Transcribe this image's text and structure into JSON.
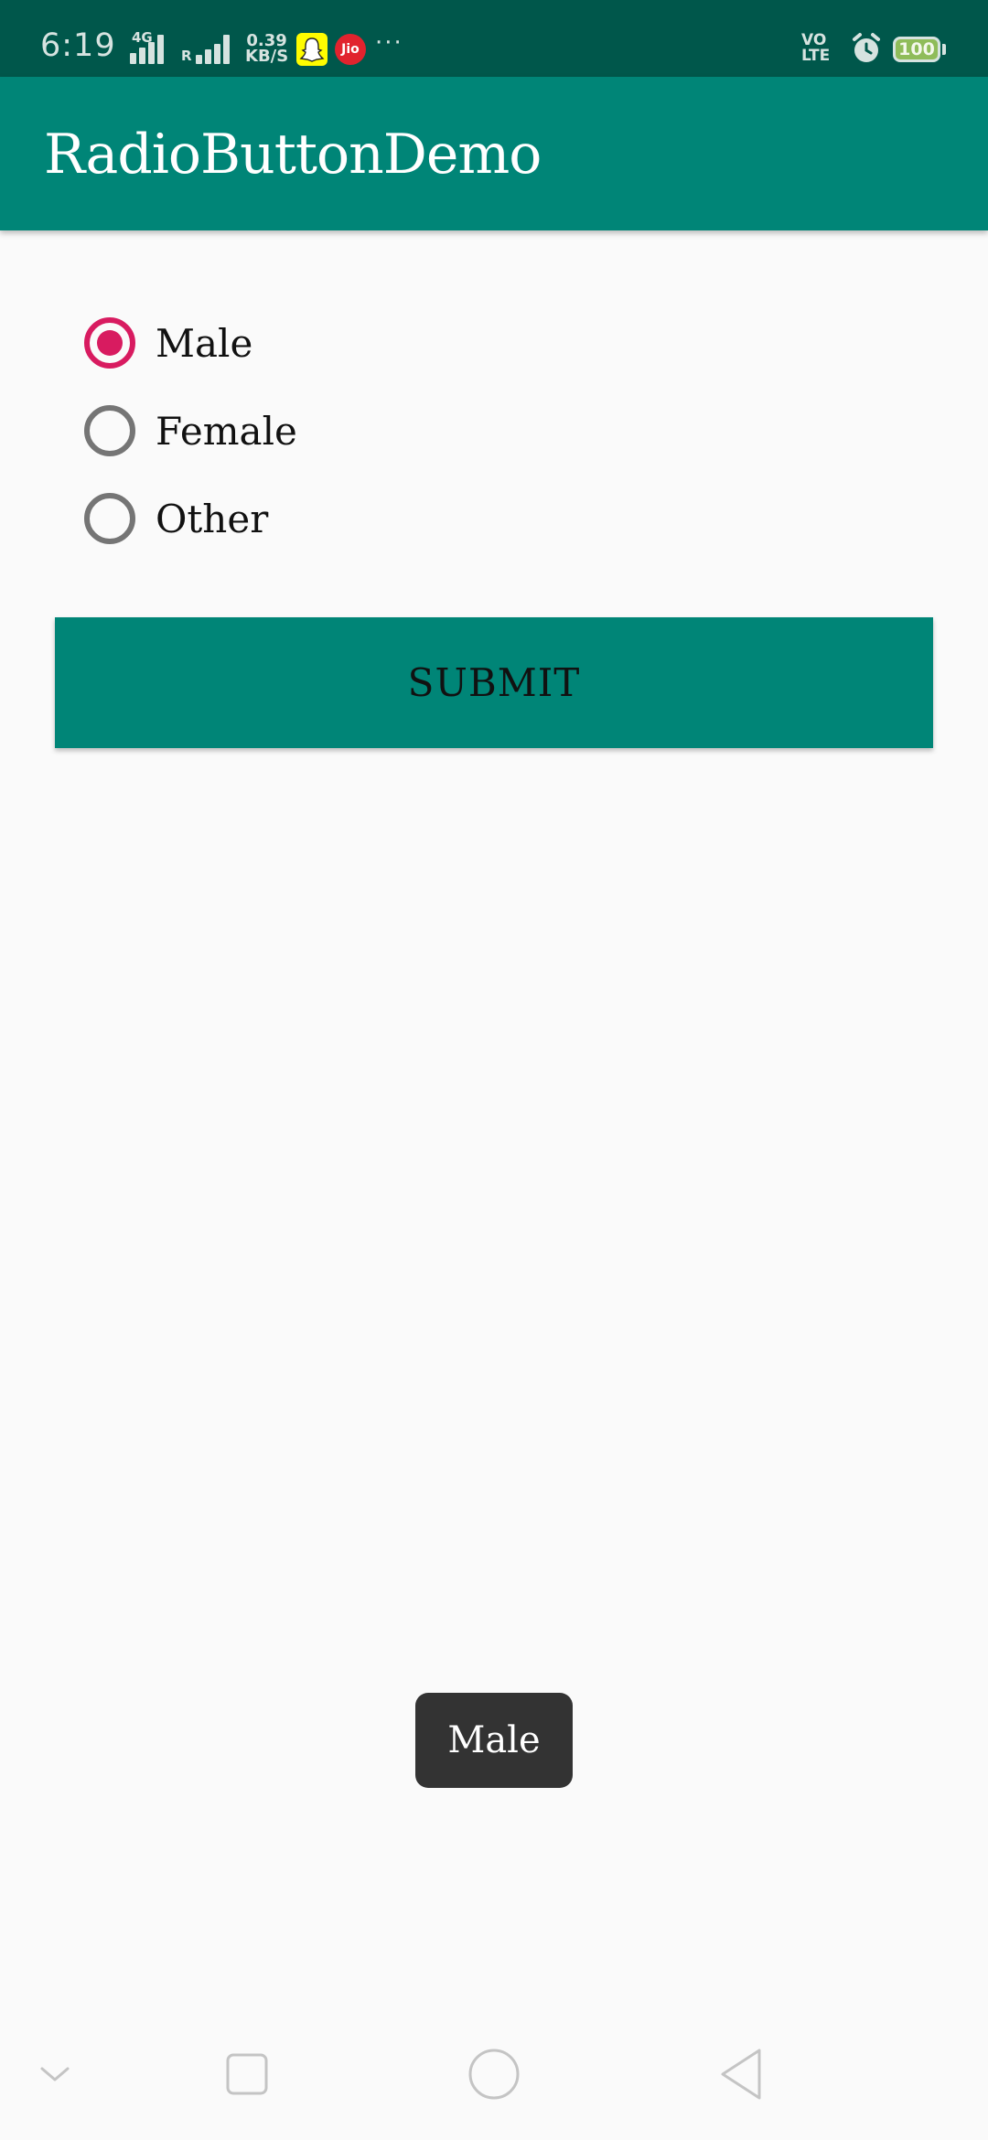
{
  "status_bar": {
    "time": "6:19",
    "network_type": "4G",
    "roaming_indicator": "R",
    "data_speed_value": "0.39",
    "data_speed_unit": "KB/S",
    "jio_label": "Jio",
    "overflow": "···",
    "volte_line1": "VO",
    "volte_line2": "LTE",
    "battery_level": "100"
  },
  "app_bar": {
    "title": "RadioButtonDemo"
  },
  "radio_group": {
    "options": [
      {
        "label": "Male",
        "checked": true
      },
      {
        "label": "Female",
        "checked": false
      },
      {
        "label": "Other",
        "checked": false
      }
    ]
  },
  "submit_button": {
    "label": "SUBMIT"
  },
  "toast": {
    "message": "Male"
  },
  "colors": {
    "status_bar": "#00574b",
    "primary": "#008577",
    "accent": "#d81b60",
    "background": "#fafafa",
    "toast_bg": "#333333"
  },
  "nav_icons": [
    "chevron-down-icon",
    "recents-square-icon",
    "home-circle-icon",
    "back-triangle-icon"
  ]
}
